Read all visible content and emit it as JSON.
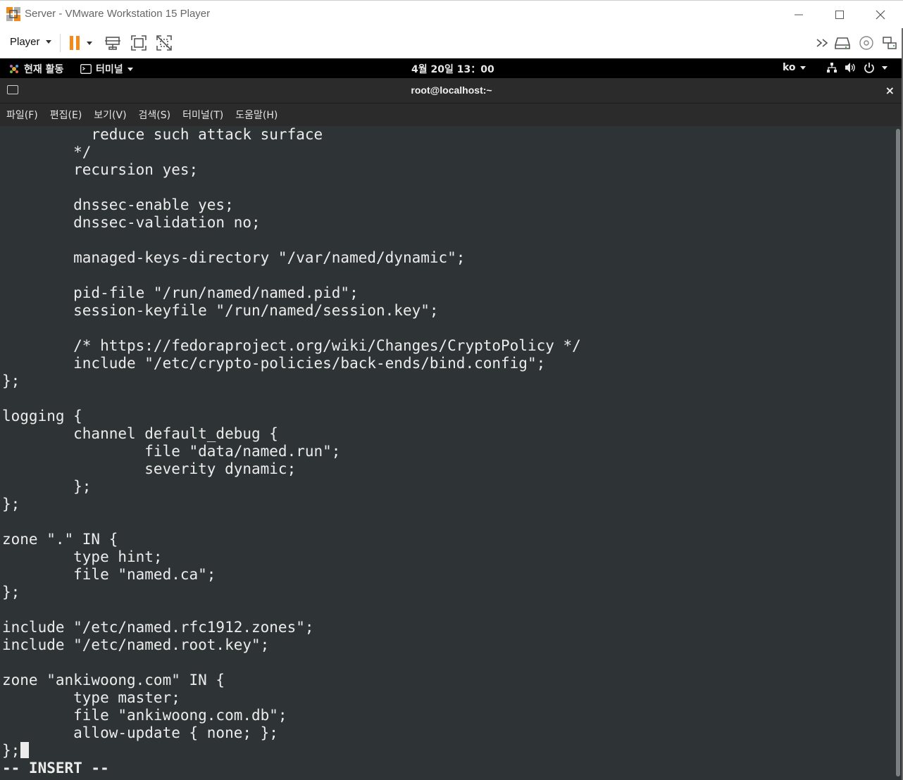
{
  "window": {
    "title": "Server - VMware Workstation 15 Player",
    "minimize_icon": "minimize-icon",
    "maximize_icon": "maximize-icon",
    "close_icon": "close-icon"
  },
  "toolbar": {
    "player_label": "Player",
    "icons": [
      "pause-icon",
      "chevron-down-icon",
      "send-ctrl-alt-del-icon",
      "fullscreen-icon",
      "unity-icon",
      "double-chevron-icon",
      "hard-disk-icon",
      "cd-rom-icon",
      "network-adapter-icon"
    ],
    "accent_color": "#f28b1c"
  },
  "gnome_bar": {
    "activities": "현재 활동",
    "app_menu": "터미널",
    "clock": "4월 20일  13：00",
    "input_method": "ko",
    "status_icons": [
      "network-icon",
      "volume-icon",
      "power-icon"
    ]
  },
  "terminal": {
    "title": "root@localhost:~",
    "close": "×",
    "menu": [
      "파일(F)",
      "편집(E)",
      "보기(V)",
      "검색(S)",
      "터미널(T)",
      "도움말(H)"
    ],
    "lines": [
      "          reduce such attack surface",
      "        */",
      "        recursion yes;",
      "",
      "        dnssec-enable yes;",
      "        dnssec-validation no;",
      "",
      "        managed-keys-directory \"/var/named/dynamic\";",
      "",
      "        pid-file \"/run/named/named.pid\";",
      "        session-keyfile \"/run/named/session.key\";",
      "",
      "        /* https://fedoraproject.org/wiki/Changes/CryptoPolicy */",
      "        include \"/etc/crypto-policies/back-ends/bind.config\";",
      "};",
      "",
      "logging {",
      "        channel default_debug {",
      "                file \"data/named.run\";",
      "                severity dynamic;",
      "        };",
      "};",
      "",
      "zone \".\" IN {",
      "        type hint;",
      "        file \"named.ca\";",
      "};",
      "",
      "include \"/etc/named.rfc1912.zones\";",
      "include \"/etc/named.root.key\";",
      "",
      "zone \"ankiwoong.com\" IN {",
      "        type master;",
      "        file \"ankiwoong.com.db\";",
      "        allow-update { none; };",
      "};"
    ],
    "status": "-- INSERT --",
    "background_color": "#2e3436",
    "text_color": "#ececec"
  }
}
